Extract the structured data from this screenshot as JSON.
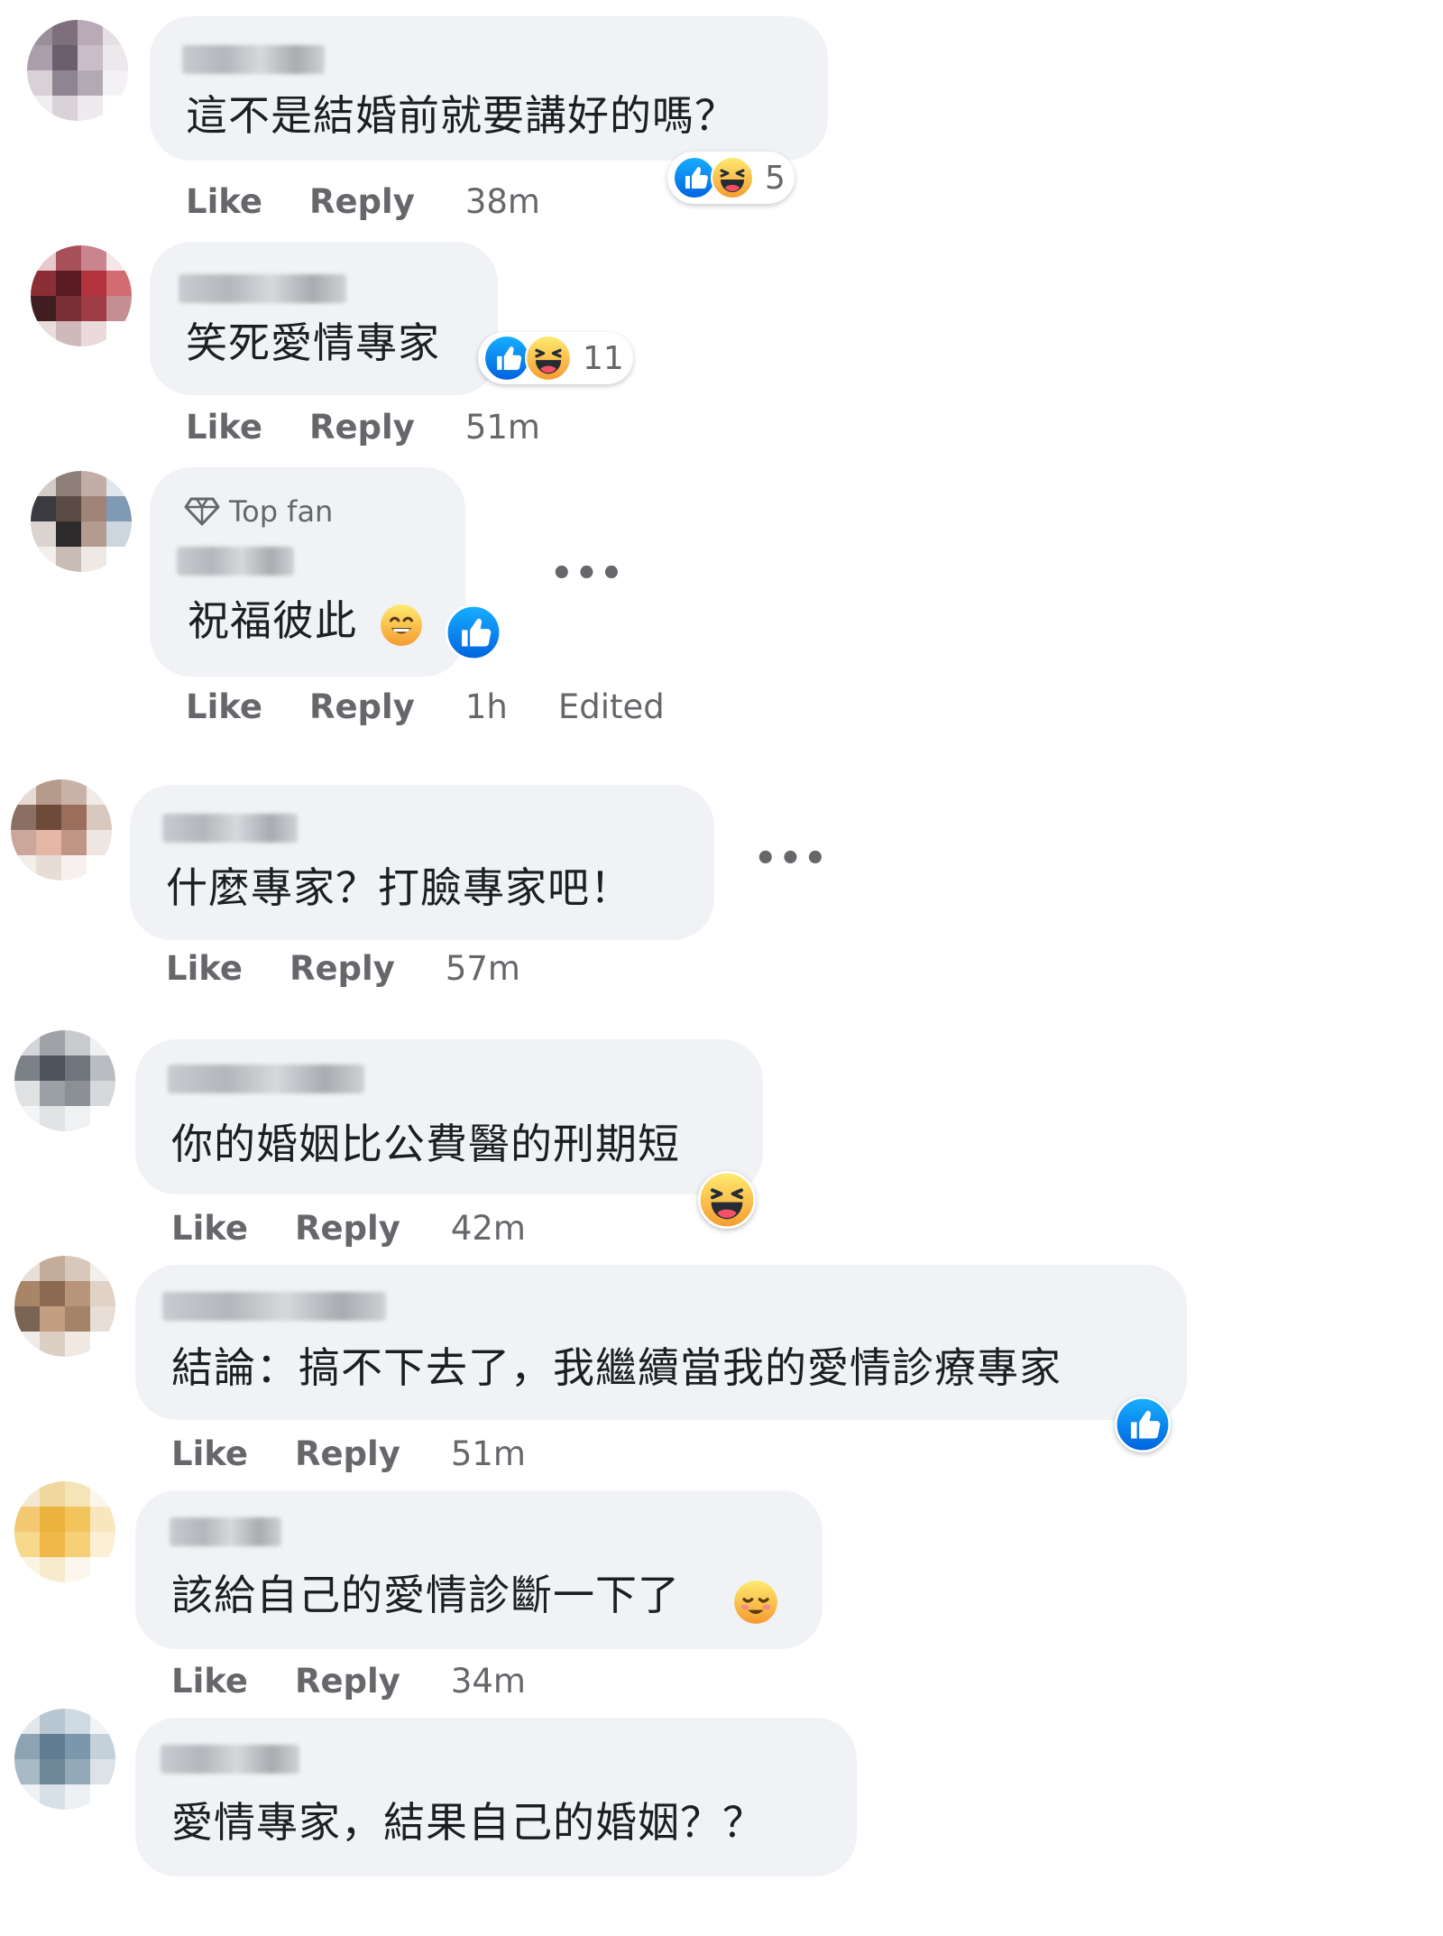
{
  "like_label": "Like",
  "reply_label": "Reply",
  "comments": [
    {
      "text": "這不是結婚前就要講好的嗎？",
      "time": "38m",
      "reactions": [
        "like-icon",
        "haha-icon"
      ],
      "reaction_count": "5"
    },
    {
      "text": "笑死愛情專家",
      "time": "51m",
      "reactions": [
        "like-icon",
        "haha-icon"
      ],
      "reaction_count": "11"
    },
    {
      "badge": "Top fan",
      "text": "祝福彼此",
      "inline_emoji": "smiling-face-icon",
      "time": "1h",
      "edited": "Edited",
      "reactions": [
        "like-icon"
      ]
    },
    {
      "text": "什麼專家？打臉專家吧！",
      "time": "57m"
    },
    {
      "text": "你的婚姻比公費醫的刑期短",
      "time": "42m",
      "reactions": [
        "haha-icon"
      ]
    },
    {
      "text": "結論：搞不下去了，我繼續當我的愛情診療專家",
      "time": "51m",
      "reactions": [
        "like-icon"
      ]
    },
    {
      "text": "該給自己的愛情診斷一下了",
      "inline_emoji": "relieved-face-icon",
      "time": "34m"
    },
    {
      "text": "愛情專家，結果自己的婚姻？？"
    }
  ],
  "colors": {
    "bubble": "#f0f2f5",
    "meta_text": "#65676b",
    "like_blue": "#1877f2",
    "haha_yellow": "#f7b125"
  }
}
